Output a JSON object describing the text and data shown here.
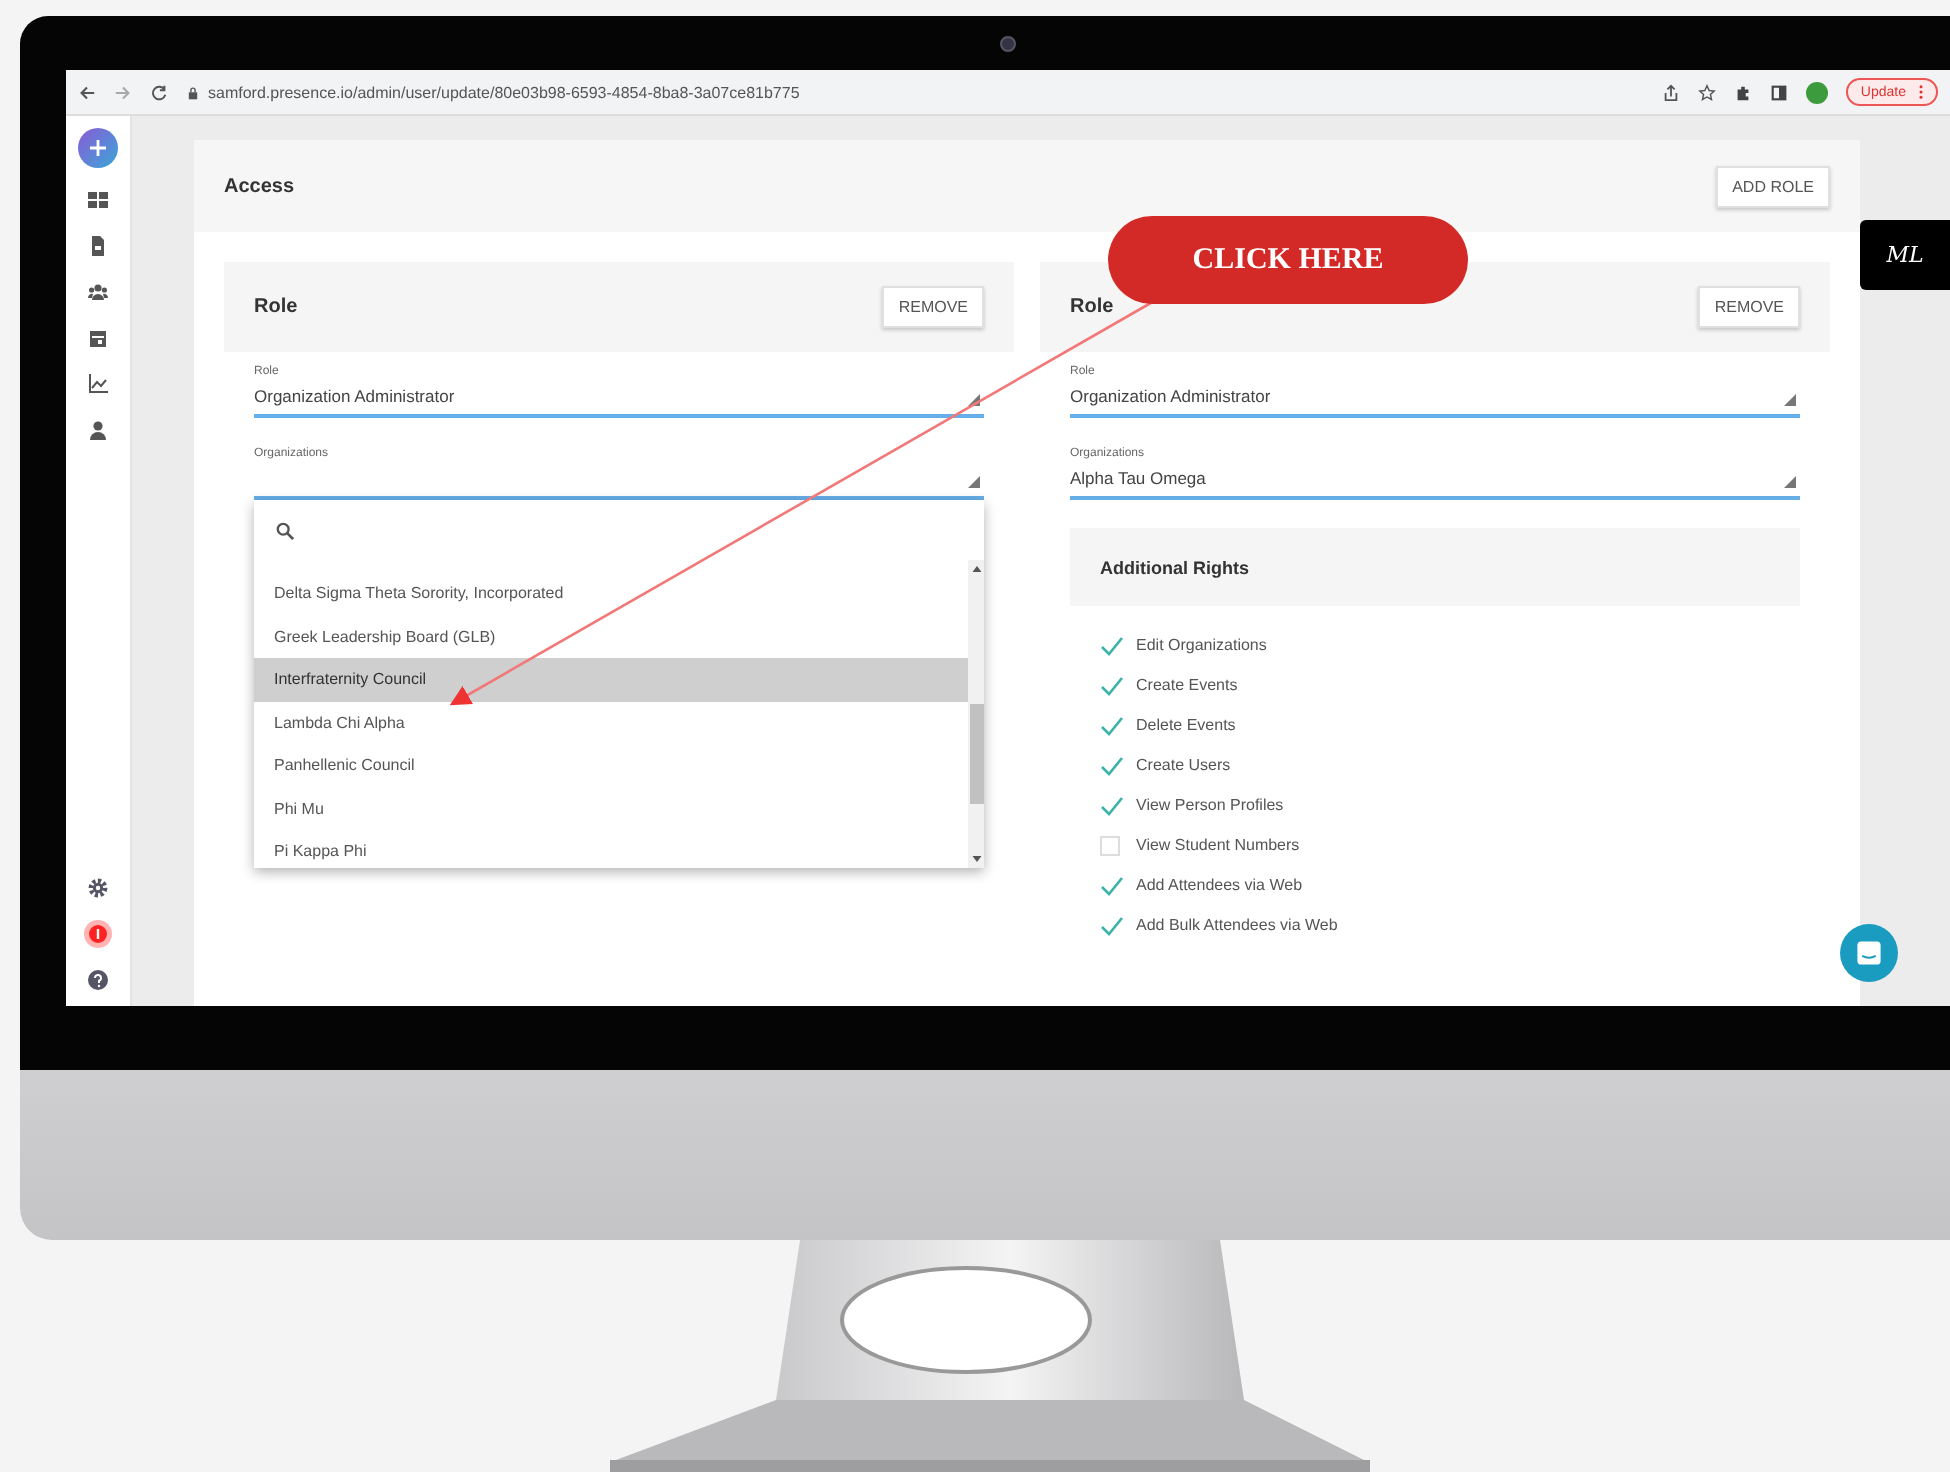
{
  "browser": {
    "url": "samford.presence.io/admin/user/update/80e03b98-6593-4854-8ba8-3a07ce81b775",
    "update_button": "Update"
  },
  "section": {
    "title": "Access",
    "add_button": "ADD ROLE"
  },
  "roles": [
    {
      "title": "Role",
      "remove_button": "REMOVE",
      "fields": [
        {
          "label": "Role",
          "value": "Organization Administrator"
        },
        {
          "label": "Organizations"
        }
      ],
      "dropdown": {
        "items": [
          {
            "label": "Delta Sigma Theta Sorority, Incorporated",
            "selected": false
          },
          {
            "label": "Greek Leadership Board (GLB)",
            "selected": false
          },
          {
            "label": "Interfraternity Council",
            "selected": true
          },
          {
            "label": "Lambda Chi Alpha",
            "selected": false
          },
          {
            "label": "Panhellenic Council",
            "selected": false
          },
          {
            "label": "Phi Mu",
            "selected": false
          },
          {
            "label": "Pi Kappa Phi",
            "selected": false
          }
        ]
      }
    },
    {
      "title": "Role",
      "remove_button": "REMOVE",
      "fields": [
        {
          "label": "Role",
          "value": "Organization Administrator"
        },
        {
          "label": "Organizations",
          "value": "Alpha Tau Omega"
        }
      ],
      "rights": {
        "title": "Additional Rights",
        "items": [
          {
            "label": "Edit Organizations",
            "checked": true
          },
          {
            "label": "Create Events",
            "checked": true
          },
          {
            "label": "Delete Events",
            "checked": true
          },
          {
            "label": "Create Users",
            "checked": true
          },
          {
            "label": "View Person Profiles",
            "checked": true
          },
          {
            "label": "View Student Numbers",
            "checked": false
          },
          {
            "label": "Add Attendees via Web",
            "checked": true
          },
          {
            "label": "Add Bulk Attendees via Web",
            "checked": true
          }
        ]
      }
    }
  ],
  "side_badge": "ML",
  "callout": {
    "label": "CLICK HERE"
  }
}
